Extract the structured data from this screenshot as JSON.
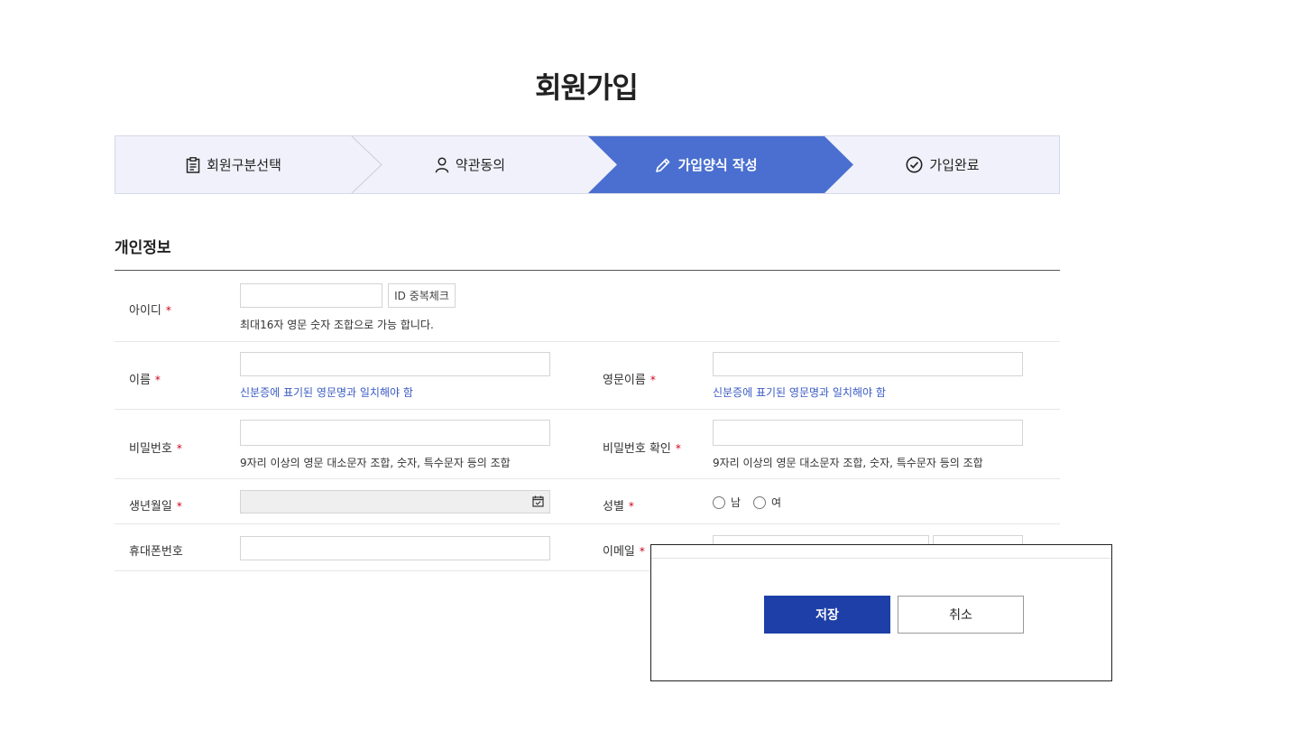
{
  "page": {
    "title": "회원가입"
  },
  "steps": [
    {
      "label": "회원구분선택",
      "icon": "clipboard-icon",
      "active": false
    },
    {
      "label": "약관동의",
      "icon": "person-icon",
      "active": false
    },
    {
      "label": "가입양식 작성",
      "icon": "pencil-icon",
      "active": true
    },
    {
      "label": "가입완료",
      "icon": "check-circle-icon",
      "active": false
    }
  ],
  "colors": {
    "active_step": "#4a6fd0",
    "step_bg": "#f0f1fa",
    "required": "#d0021b",
    "primary_button": "#1e3fa8",
    "hint_blue": "#3b5bc4"
  },
  "section": {
    "title": "개인정보"
  },
  "required_mark": "*",
  "form": {
    "user_id": {
      "label": "아이디",
      "value": "",
      "check_button": "ID 중복체크",
      "hint": "최대16자 영문 숫자 조합으로 가능 합니다."
    },
    "name": {
      "label": "이름",
      "value": "",
      "hint": "신분증에 표기된 영문명과 일치해야 함"
    },
    "english_name": {
      "label": "영문이름",
      "value": "",
      "hint": "신분증에 표기된 영문명과 일치해야 함"
    },
    "password": {
      "label": "비밀번호",
      "value": "",
      "hint": "9자리 이상의 영문 대소문자 조합, 숫자, 특수문자 등의 조합"
    },
    "password_confirm": {
      "label": "비밀번호 확인",
      "value": "",
      "hint": "9자리 이상의 영문 대소문자 조합, 숫자, 특수문자 등의 조합"
    },
    "birthdate": {
      "label": "생년월일",
      "value": ""
    },
    "gender": {
      "label": "성별",
      "options": [
        "남",
        "여"
      ]
    },
    "phone": {
      "label": "휴대폰번호",
      "value": ""
    },
    "email": {
      "label": "이메일",
      "value": ""
    }
  },
  "dialog": {
    "save_label": "저장",
    "cancel_label": "취소"
  }
}
